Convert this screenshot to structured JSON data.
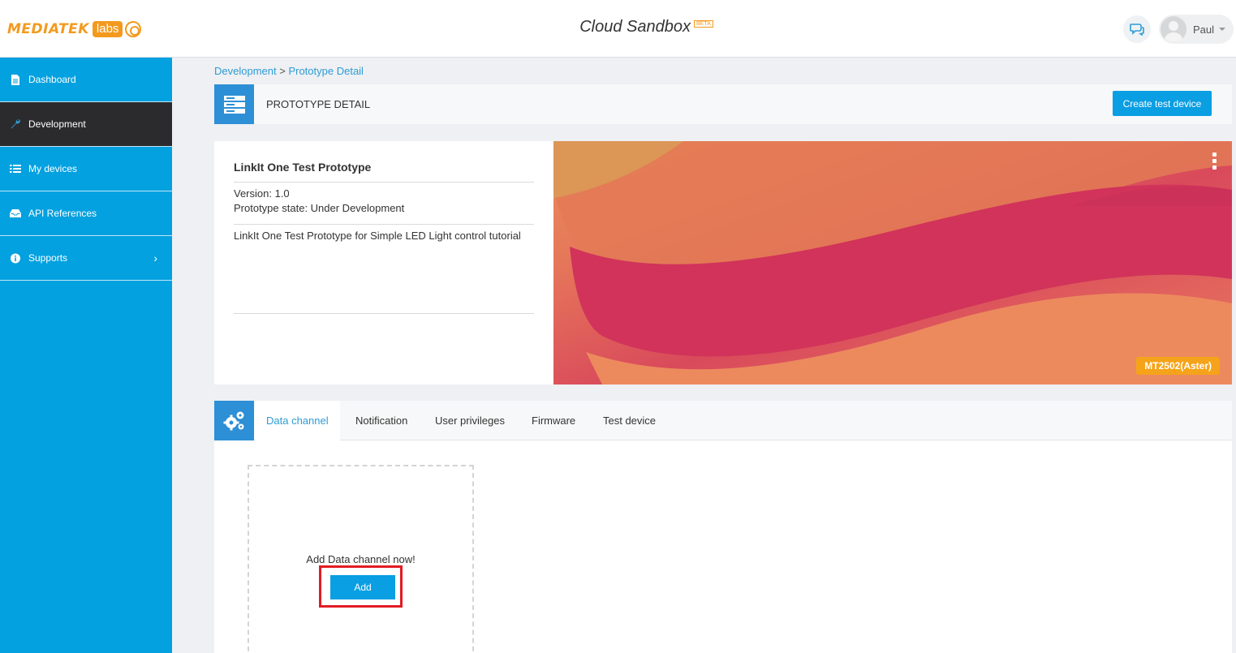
{
  "header": {
    "logo_text": "MEDIATEK",
    "logo_labs": "labs",
    "app_title": "Cloud Sandbox",
    "beta_badge": "BETA",
    "user_name": "Paul"
  },
  "sidebar": {
    "items": [
      {
        "label": "Dashboard",
        "icon": "document-icon"
      },
      {
        "label": "Development",
        "icon": "wrench-icon"
      },
      {
        "label": "My devices",
        "icon": "list-icon"
      },
      {
        "label": "API References",
        "icon": "inbox-icon"
      },
      {
        "label": "Supports",
        "icon": "info-icon"
      }
    ]
  },
  "breadcrumb": {
    "parent": "Development",
    "separator": ">",
    "current": "Prototype Detail"
  },
  "page_header": {
    "title": "PROTOTYPE DETAIL",
    "create_button": "Create test device"
  },
  "prototype": {
    "name": "LinkIt One Test Prototype",
    "version": "Version: 1.0",
    "state": "Prototype state: Under Development",
    "description": "LinkIt One Test Prototype for Simple LED Light control tutorial",
    "chip": "MT2502(Aster)"
  },
  "tabs": [
    {
      "label": "Data channel"
    },
    {
      "label": "Notification"
    },
    {
      "label": "User privileges"
    },
    {
      "label": "Firmware"
    },
    {
      "label": "Test device"
    }
  ],
  "data_channel": {
    "empty_text": "Add Data channel now!",
    "add_button": "Add"
  },
  "colors": {
    "sidebar": "#03a1e0",
    "active_nav": "#2b2b2d",
    "primary_button": "#0a9ee3",
    "brand_orange": "#f39a1e",
    "highlight_red": "#e21b23"
  }
}
